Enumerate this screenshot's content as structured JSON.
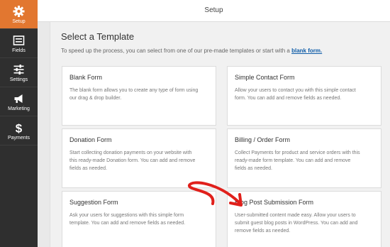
{
  "sidebar": {
    "items": [
      {
        "label": "Setup",
        "icon": "gear-icon"
      },
      {
        "label": "Fields",
        "icon": "fields-list-icon"
      },
      {
        "label": "Settings",
        "icon": "sliders-icon"
      },
      {
        "label": "Marketing",
        "icon": "megaphone-icon"
      },
      {
        "label": "Payments",
        "icon": "dollar-icon"
      }
    ],
    "active_color": "#e27730",
    "background": "#2f2f2f"
  },
  "header": {
    "title": "Setup"
  },
  "main": {
    "title": "Select a Template",
    "desc_prefix": "To speed up the process, you can select from one of our pre-made templates or start with a",
    "desc_link": "blank form.",
    "templates": [
      {
        "name": "Blank Form",
        "lines": [
          "The blank form allows you to create any type of form using",
          "our drag & drop builder."
        ]
      },
      {
        "name": "Simple Contact Form",
        "lines": [
          "Allow your users to contact you with this simple contact",
          "form. You can add and remove fields as needed."
        ]
      },
      {
        "name": "Donation Form",
        "lines": [
          "Start collecting donation payments on your website with",
          "this ready-made Donation form. You can add and remove",
          "fields as needed."
        ]
      },
      {
        "name": "Billing / Order Form",
        "lines": [
          "Collect Payments for product and service orders with this",
          "ready-made form template. You can add and remove",
          "fields as needed."
        ]
      },
      {
        "name": "Suggestion Form",
        "lines": [
          "Ask your users for suggestions with this simple form",
          "template. You can add and remove fields as needed."
        ]
      },
      {
        "name": "Blog Post Submission Form",
        "lines": [
          "User-submitted content made easy. Allow your users to",
          "submit guest blog posts in WordPress. You can add and",
          "remove fields as needed."
        ]
      }
    ]
  },
  "annotation": {
    "arrow_color": "#e0201b"
  }
}
